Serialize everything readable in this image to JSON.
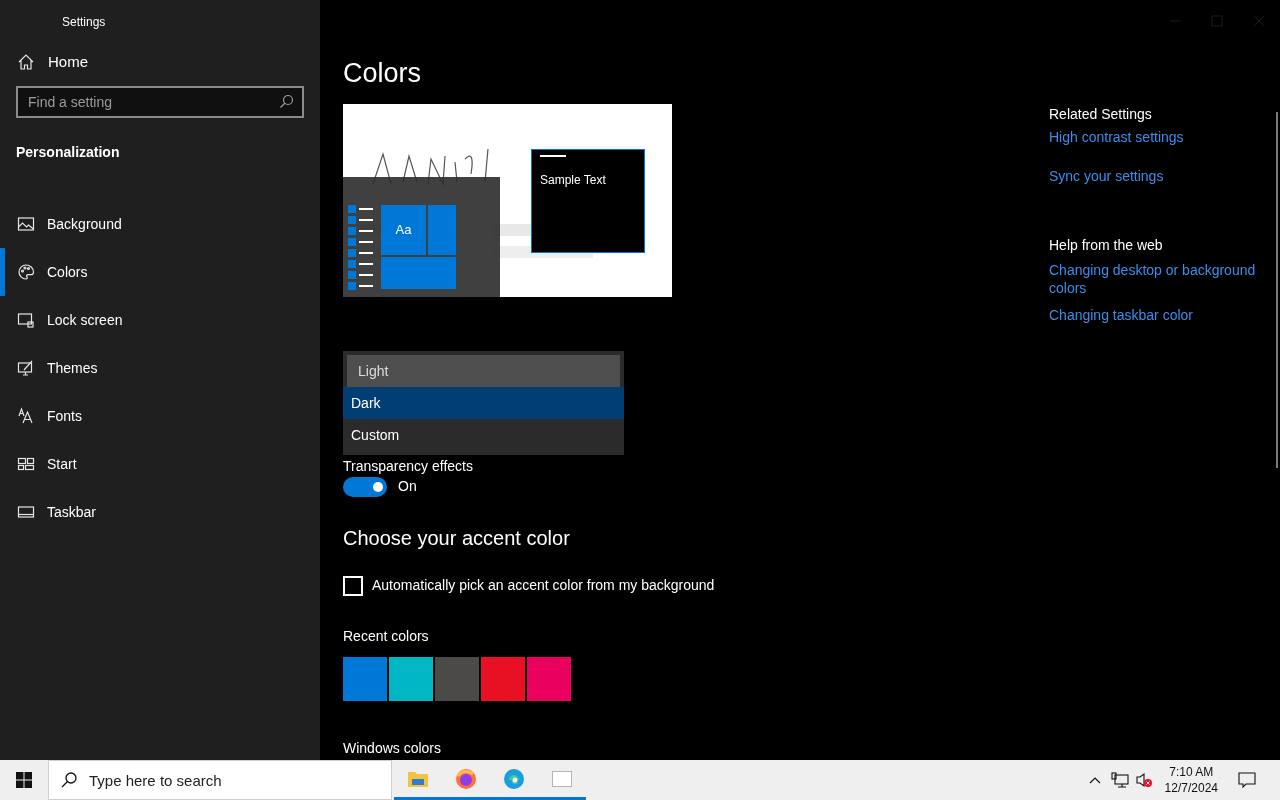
{
  "window": {
    "title": "Settings"
  },
  "sidebar": {
    "home": "Home",
    "search": {
      "placeholder": "Find a setting"
    },
    "section": "Personalization",
    "items": [
      {
        "label": "Background",
        "selected": false
      },
      {
        "label": "Colors",
        "selected": true
      },
      {
        "label": "Lock screen",
        "selected": false
      },
      {
        "label": "Themes",
        "selected": false
      },
      {
        "label": "Fonts",
        "selected": false
      },
      {
        "label": "Start",
        "selected": false
      },
      {
        "label": "Taskbar",
        "selected": false
      }
    ]
  },
  "main": {
    "title": "Colors",
    "preview": {
      "tile_label": "Aa",
      "sample_text": "Sample Text"
    },
    "mode_menu": {
      "options": [
        {
          "label": "Light",
          "selected": false,
          "hovered": true
        },
        {
          "label": "Dark",
          "selected": true,
          "hovered": false
        },
        {
          "label": "Custom",
          "selected": false,
          "hovered": false
        }
      ]
    },
    "transparency": {
      "label": "Transparency effects",
      "on": true,
      "state_text": "On"
    },
    "accent_heading": "Choose your accent color",
    "auto_pick": {
      "label": "Automatically pick an accent color from my background",
      "checked": false
    },
    "recent_colors": {
      "label": "Recent colors",
      "swatches": [
        {
          "color": "#0078d7"
        },
        {
          "color": "#00b7c3"
        },
        {
          "color": "#4c4a48"
        },
        {
          "color": "#e81123"
        },
        {
          "color": "#ea005e"
        }
      ]
    },
    "windows_colors_label": "Windows colors"
  },
  "related": {
    "heading": "Related Settings",
    "links": [
      "High contrast settings",
      "Sync your settings"
    ]
  },
  "help": {
    "heading": "Help from the web",
    "links": [
      "Changing desktop or background colors",
      "Changing taskbar color"
    ]
  },
  "taskbar": {
    "search": {
      "placeholder": "Type here to search"
    },
    "apps": [
      {
        "running": true
      },
      {
        "running": true
      },
      {
        "running": true
      },
      {
        "running": true
      }
    ],
    "time": "7:10 AM",
    "date": "12/7/2024"
  }
}
